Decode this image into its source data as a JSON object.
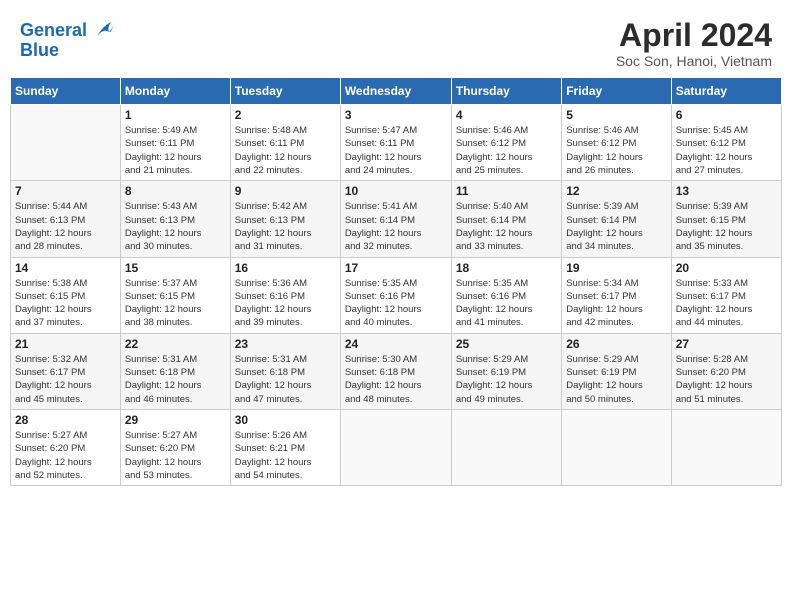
{
  "header": {
    "logo_line1": "General",
    "logo_line2": "Blue",
    "title": "April 2024",
    "subtitle": "Soc Son, Hanoi, Vietnam"
  },
  "calendar": {
    "weekdays": [
      "Sunday",
      "Monday",
      "Tuesday",
      "Wednesday",
      "Thursday",
      "Friday",
      "Saturday"
    ],
    "weeks": [
      [
        {
          "date": "",
          "info": ""
        },
        {
          "date": "1",
          "info": "Sunrise: 5:49 AM\nSunset: 6:11 PM\nDaylight: 12 hours\nand 21 minutes."
        },
        {
          "date": "2",
          "info": "Sunrise: 5:48 AM\nSunset: 6:11 PM\nDaylight: 12 hours\nand 22 minutes."
        },
        {
          "date": "3",
          "info": "Sunrise: 5:47 AM\nSunset: 6:11 PM\nDaylight: 12 hours\nand 24 minutes."
        },
        {
          "date": "4",
          "info": "Sunrise: 5:46 AM\nSunset: 6:12 PM\nDaylight: 12 hours\nand 25 minutes."
        },
        {
          "date": "5",
          "info": "Sunrise: 5:46 AM\nSunset: 6:12 PM\nDaylight: 12 hours\nand 26 minutes."
        },
        {
          "date": "6",
          "info": "Sunrise: 5:45 AM\nSunset: 6:12 PM\nDaylight: 12 hours\nand 27 minutes."
        }
      ],
      [
        {
          "date": "7",
          "info": "Sunrise: 5:44 AM\nSunset: 6:13 PM\nDaylight: 12 hours\nand 28 minutes."
        },
        {
          "date": "8",
          "info": "Sunrise: 5:43 AM\nSunset: 6:13 PM\nDaylight: 12 hours\nand 30 minutes."
        },
        {
          "date": "9",
          "info": "Sunrise: 5:42 AM\nSunset: 6:13 PM\nDaylight: 12 hours\nand 31 minutes."
        },
        {
          "date": "10",
          "info": "Sunrise: 5:41 AM\nSunset: 6:14 PM\nDaylight: 12 hours\nand 32 minutes."
        },
        {
          "date": "11",
          "info": "Sunrise: 5:40 AM\nSunset: 6:14 PM\nDaylight: 12 hours\nand 33 minutes."
        },
        {
          "date": "12",
          "info": "Sunrise: 5:39 AM\nSunset: 6:14 PM\nDaylight: 12 hours\nand 34 minutes."
        },
        {
          "date": "13",
          "info": "Sunrise: 5:39 AM\nSunset: 6:15 PM\nDaylight: 12 hours\nand 35 minutes."
        }
      ],
      [
        {
          "date": "14",
          "info": "Sunrise: 5:38 AM\nSunset: 6:15 PM\nDaylight: 12 hours\nand 37 minutes."
        },
        {
          "date": "15",
          "info": "Sunrise: 5:37 AM\nSunset: 6:15 PM\nDaylight: 12 hours\nand 38 minutes."
        },
        {
          "date": "16",
          "info": "Sunrise: 5:36 AM\nSunset: 6:16 PM\nDaylight: 12 hours\nand 39 minutes."
        },
        {
          "date": "17",
          "info": "Sunrise: 5:35 AM\nSunset: 6:16 PM\nDaylight: 12 hours\nand 40 minutes."
        },
        {
          "date": "18",
          "info": "Sunrise: 5:35 AM\nSunset: 6:16 PM\nDaylight: 12 hours\nand 41 minutes."
        },
        {
          "date": "19",
          "info": "Sunrise: 5:34 AM\nSunset: 6:17 PM\nDaylight: 12 hours\nand 42 minutes."
        },
        {
          "date": "20",
          "info": "Sunrise: 5:33 AM\nSunset: 6:17 PM\nDaylight: 12 hours\nand 44 minutes."
        }
      ],
      [
        {
          "date": "21",
          "info": "Sunrise: 5:32 AM\nSunset: 6:17 PM\nDaylight: 12 hours\nand 45 minutes."
        },
        {
          "date": "22",
          "info": "Sunrise: 5:31 AM\nSunset: 6:18 PM\nDaylight: 12 hours\nand 46 minutes."
        },
        {
          "date": "23",
          "info": "Sunrise: 5:31 AM\nSunset: 6:18 PM\nDaylight: 12 hours\nand 47 minutes."
        },
        {
          "date": "24",
          "info": "Sunrise: 5:30 AM\nSunset: 6:18 PM\nDaylight: 12 hours\nand 48 minutes."
        },
        {
          "date": "25",
          "info": "Sunrise: 5:29 AM\nSunset: 6:19 PM\nDaylight: 12 hours\nand 49 minutes."
        },
        {
          "date": "26",
          "info": "Sunrise: 5:29 AM\nSunset: 6:19 PM\nDaylight: 12 hours\nand 50 minutes."
        },
        {
          "date": "27",
          "info": "Sunrise: 5:28 AM\nSunset: 6:20 PM\nDaylight: 12 hours\nand 51 minutes."
        }
      ],
      [
        {
          "date": "28",
          "info": "Sunrise: 5:27 AM\nSunset: 6:20 PM\nDaylight: 12 hours\nand 52 minutes."
        },
        {
          "date": "29",
          "info": "Sunrise: 5:27 AM\nSunset: 6:20 PM\nDaylight: 12 hours\nand 53 minutes."
        },
        {
          "date": "30",
          "info": "Sunrise: 5:26 AM\nSunset: 6:21 PM\nDaylight: 12 hours\nand 54 minutes."
        },
        {
          "date": "",
          "info": ""
        },
        {
          "date": "",
          "info": ""
        },
        {
          "date": "",
          "info": ""
        },
        {
          "date": "",
          "info": ""
        }
      ]
    ]
  }
}
